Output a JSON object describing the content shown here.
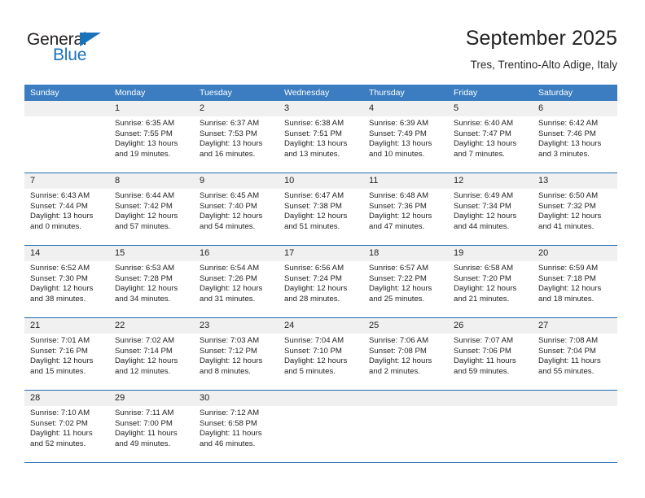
{
  "brand": {
    "name_dark": "General",
    "name_blue": "Blue",
    "accent_color": "#1a72bb",
    "header_color": "#3b7dc0",
    "grid_line_color": "#1f6bb0",
    "day_band_color": "#f0f0f0"
  },
  "header": {
    "title": "September 2025",
    "subtitle": "Tres, Trentino-Alto Adige, Italy"
  },
  "weekdays": [
    "Sunday",
    "Monday",
    "Tuesday",
    "Wednesday",
    "Thursday",
    "Friday",
    "Saturday"
  ],
  "weeks": [
    [
      {
        "day": "",
        "lines": []
      },
      {
        "day": "1",
        "lines": [
          "Sunrise: 6:35 AM",
          "Sunset: 7:55 PM",
          "Daylight: 13 hours",
          "and 19 minutes."
        ]
      },
      {
        "day": "2",
        "lines": [
          "Sunrise: 6:37 AM",
          "Sunset: 7:53 PM",
          "Daylight: 13 hours",
          "and 16 minutes."
        ]
      },
      {
        "day": "3",
        "lines": [
          "Sunrise: 6:38 AM",
          "Sunset: 7:51 PM",
          "Daylight: 13 hours",
          "and 13 minutes."
        ]
      },
      {
        "day": "4",
        "lines": [
          "Sunrise: 6:39 AM",
          "Sunset: 7:49 PM",
          "Daylight: 13 hours",
          "and 10 minutes."
        ]
      },
      {
        "day": "5",
        "lines": [
          "Sunrise: 6:40 AM",
          "Sunset: 7:47 PM",
          "Daylight: 13 hours",
          "and 7 minutes."
        ]
      },
      {
        "day": "6",
        "lines": [
          "Sunrise: 6:42 AM",
          "Sunset: 7:46 PM",
          "Daylight: 13 hours",
          "and 3 minutes."
        ]
      }
    ],
    [
      {
        "day": "7",
        "lines": [
          "Sunrise: 6:43 AM",
          "Sunset: 7:44 PM",
          "Daylight: 13 hours",
          "and 0 minutes."
        ]
      },
      {
        "day": "8",
        "lines": [
          "Sunrise: 6:44 AM",
          "Sunset: 7:42 PM",
          "Daylight: 12 hours",
          "and 57 minutes."
        ]
      },
      {
        "day": "9",
        "lines": [
          "Sunrise: 6:45 AM",
          "Sunset: 7:40 PM",
          "Daylight: 12 hours",
          "and 54 minutes."
        ]
      },
      {
        "day": "10",
        "lines": [
          "Sunrise: 6:47 AM",
          "Sunset: 7:38 PM",
          "Daylight: 12 hours",
          "and 51 minutes."
        ]
      },
      {
        "day": "11",
        "lines": [
          "Sunrise: 6:48 AM",
          "Sunset: 7:36 PM",
          "Daylight: 12 hours",
          "and 47 minutes."
        ]
      },
      {
        "day": "12",
        "lines": [
          "Sunrise: 6:49 AM",
          "Sunset: 7:34 PM",
          "Daylight: 12 hours",
          "and 44 minutes."
        ]
      },
      {
        "day": "13",
        "lines": [
          "Sunrise: 6:50 AM",
          "Sunset: 7:32 PM",
          "Daylight: 12 hours",
          "and 41 minutes."
        ]
      }
    ],
    [
      {
        "day": "14",
        "lines": [
          "Sunrise: 6:52 AM",
          "Sunset: 7:30 PM",
          "Daylight: 12 hours",
          "and 38 minutes."
        ]
      },
      {
        "day": "15",
        "lines": [
          "Sunrise: 6:53 AM",
          "Sunset: 7:28 PM",
          "Daylight: 12 hours",
          "and 34 minutes."
        ]
      },
      {
        "day": "16",
        "lines": [
          "Sunrise: 6:54 AM",
          "Sunset: 7:26 PM",
          "Daylight: 12 hours",
          "and 31 minutes."
        ]
      },
      {
        "day": "17",
        "lines": [
          "Sunrise: 6:56 AM",
          "Sunset: 7:24 PM",
          "Daylight: 12 hours",
          "and 28 minutes."
        ]
      },
      {
        "day": "18",
        "lines": [
          "Sunrise: 6:57 AM",
          "Sunset: 7:22 PM",
          "Daylight: 12 hours",
          "and 25 minutes."
        ]
      },
      {
        "day": "19",
        "lines": [
          "Sunrise: 6:58 AM",
          "Sunset: 7:20 PM",
          "Daylight: 12 hours",
          "and 21 minutes."
        ]
      },
      {
        "day": "20",
        "lines": [
          "Sunrise: 6:59 AM",
          "Sunset: 7:18 PM",
          "Daylight: 12 hours",
          "and 18 minutes."
        ]
      }
    ],
    [
      {
        "day": "21",
        "lines": [
          "Sunrise: 7:01 AM",
          "Sunset: 7:16 PM",
          "Daylight: 12 hours",
          "and 15 minutes."
        ]
      },
      {
        "day": "22",
        "lines": [
          "Sunrise: 7:02 AM",
          "Sunset: 7:14 PM",
          "Daylight: 12 hours",
          "and 12 minutes."
        ]
      },
      {
        "day": "23",
        "lines": [
          "Sunrise: 7:03 AM",
          "Sunset: 7:12 PM",
          "Daylight: 12 hours",
          "and 8 minutes."
        ]
      },
      {
        "day": "24",
        "lines": [
          "Sunrise: 7:04 AM",
          "Sunset: 7:10 PM",
          "Daylight: 12 hours",
          "and 5 minutes."
        ]
      },
      {
        "day": "25",
        "lines": [
          "Sunrise: 7:06 AM",
          "Sunset: 7:08 PM",
          "Daylight: 12 hours",
          "and 2 minutes."
        ]
      },
      {
        "day": "26",
        "lines": [
          "Sunrise: 7:07 AM",
          "Sunset: 7:06 PM",
          "Daylight: 11 hours",
          "and 59 minutes."
        ]
      },
      {
        "day": "27",
        "lines": [
          "Sunrise: 7:08 AM",
          "Sunset: 7:04 PM",
          "Daylight: 11 hours",
          "and 55 minutes."
        ]
      }
    ],
    [
      {
        "day": "28",
        "lines": [
          "Sunrise: 7:10 AM",
          "Sunset: 7:02 PM",
          "Daylight: 11 hours",
          "and 52 minutes."
        ]
      },
      {
        "day": "29",
        "lines": [
          "Sunrise: 7:11 AM",
          "Sunset: 7:00 PM",
          "Daylight: 11 hours",
          "and 49 minutes."
        ]
      },
      {
        "day": "30",
        "lines": [
          "Sunrise: 7:12 AM",
          "Sunset: 6:58 PM",
          "Daylight: 11 hours",
          "and 46 minutes."
        ]
      },
      {
        "day": "",
        "lines": []
      },
      {
        "day": "",
        "lines": []
      },
      {
        "day": "",
        "lines": []
      },
      {
        "day": "",
        "lines": []
      }
    ]
  ]
}
